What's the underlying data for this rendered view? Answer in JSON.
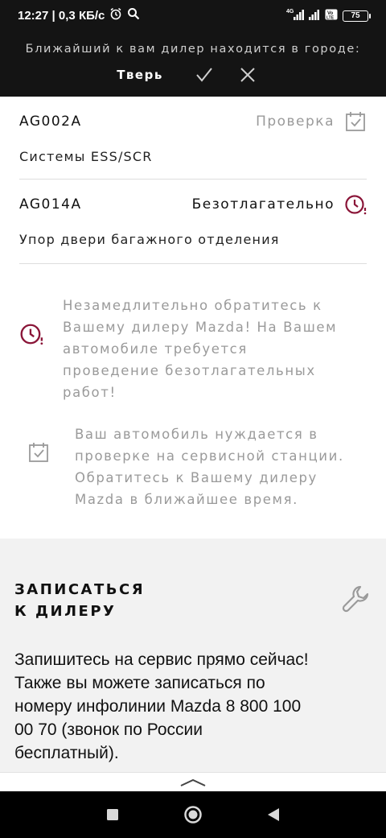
{
  "status_bar": {
    "time": "12:27",
    "speed": "0,3 КБ/с",
    "network_label": "4G",
    "battery": "75",
    "icons": [
      "alarm-icon",
      "search-icon",
      "signal-icon",
      "volte-icon",
      "battery-icon"
    ]
  },
  "dealer_banner": {
    "question": "Ближайший к вам дилер находится в городе:",
    "city": "Тверь",
    "icons": [
      "check-icon",
      "close-icon"
    ]
  },
  "warnings": [
    {
      "code": "AG002A",
      "status": "Проверка",
      "description": "Системы ESS/SCR",
      "status_color": "#9a9a9a",
      "icon": "calendar-check-icon"
    },
    {
      "code": "AG014A",
      "status": "Безотлагательно",
      "description": "Упор двери багажного отделения",
      "status_color": "#111111",
      "icon": "clock-alert-icon"
    }
  ],
  "legend": {
    "urgent_lines": [
      "Незамедлительно обратитесь к",
      "Вашему дилеру Mazda! На Вашем",
      "автомобиле требуется",
      "проведение безотлагательных",
      "работ!"
    ],
    "check_lines": [
      "Ваш автомобиль нуждается в",
      "проверке на сервисной станции.",
      "Обратитесь к Вашему дилеру",
      "Mazda в ближайшее время."
    ]
  },
  "booking": {
    "title_lines": [
      "ЗАПИСАТЬСЯ",
      "К ДИЛЕРУ"
    ],
    "text_lines": [
      "Запишитесь на сервис прямо сейчас!",
      "Также вы можете записаться по",
      "номеру инфолинии Mazda 8 800 100",
      "00 70 (звонок по России",
      "бесплатный)."
    ],
    "icon": "wrench-icon"
  },
  "colors": {
    "accent": "#8a1538",
    "muted": "#9a9a9a",
    "dark_bg": "#141414"
  }
}
